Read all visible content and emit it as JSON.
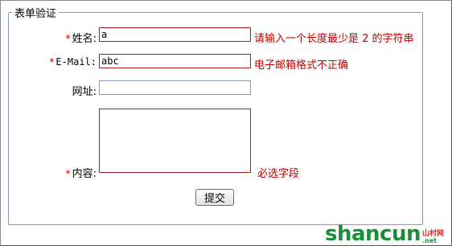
{
  "form": {
    "legend": "表单验证",
    "required_mark": "*",
    "fields": {
      "name": {
        "label": "姓名:",
        "value": "a",
        "error": "请输入一个长度最少是 2 的字符串"
      },
      "email": {
        "label": "E-Mail:",
        "value": "abc",
        "error": "电子邮箱格式不正确"
      },
      "url": {
        "label": "网址:",
        "value": ""
      },
      "content": {
        "label": "内容:",
        "value": "",
        "error": "必选字段"
      }
    },
    "submit_label": "提交"
  },
  "watermark": {
    "main": "shancun",
    "cn": "山村网",
    "net": ".net"
  },
  "colors": {
    "error": "#c00000",
    "error_border": "#b11a1a",
    "border": "#7f9db9",
    "watermark_green": "#1a8f3a",
    "watermark_orange": "#f07b1a"
  }
}
